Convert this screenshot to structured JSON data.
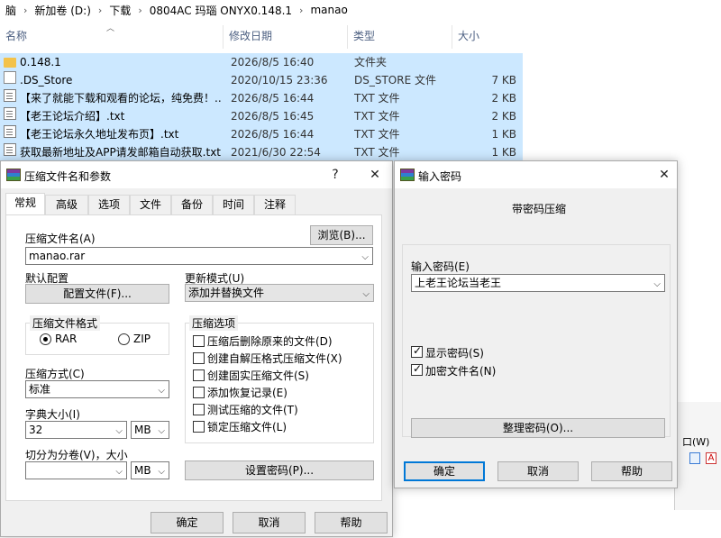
{
  "explorer": {
    "breadcrumb": [
      "脑",
      "新加卷 (D:)",
      "下载",
      "0804AC 玛瑙 ONYX0.148.1",
      "manao"
    ],
    "columns": {
      "name": "名称",
      "date": "修改日期",
      "type": "类型",
      "size": "大小"
    },
    "files": [
      {
        "name": "0.148.1",
        "date": "2026/8/5 16:40",
        "type": "文件夹",
        "size": "",
        "icon": "folder-icon"
      },
      {
        "name": ".DS_Store",
        "date": "2020/10/15 23:36",
        "type": "DS_STORE 文件",
        "size": "7 KB",
        "icon": "file-icon"
      },
      {
        "name": "【来了就能下载和观看的论坛，纯免费！...",
        "date": "2026/8/5 16:44",
        "type": "TXT 文件",
        "size": "2 KB",
        "icon": "txt-file-icon"
      },
      {
        "name": "【老王论坛介绍】.txt",
        "date": "2026/8/5 16:45",
        "type": "TXT 文件",
        "size": "2 KB",
        "icon": "txt-file-icon"
      },
      {
        "name": "【老王论坛永久地址发布页】.txt",
        "date": "2026/8/5 16:44",
        "type": "TXT 文件",
        "size": "1 KB",
        "icon": "txt-file-icon"
      },
      {
        "name": "获取最新地址及APP请发邮箱自动获取.txt",
        "date": "2021/6/30 22:54",
        "type": "TXT 文件",
        "size": "1 KB",
        "icon": "txt-file-icon"
      }
    ],
    "partial_text": "口(W)"
  },
  "archive_dialog": {
    "title": "压缩文件名和参数",
    "help_glyph": "?",
    "close_glyph": "✕",
    "tabs": [
      "常规",
      "高级",
      "选项",
      "文件",
      "备份",
      "时间",
      "注释"
    ],
    "active_tab": 0,
    "archive_name_label": "压缩文件名(A)",
    "browse_button": "浏览(B)...",
    "archive_name_value": "manao.rar",
    "default_profile_label": "默认配置",
    "profiles_button": "配置文件(F)...",
    "update_mode_label": "更新模式(U)",
    "update_mode_value": "添加并替换文件",
    "format_group_title": "压缩文件格式",
    "format_rar": "RAR",
    "format_zip": "ZIP",
    "options_group_title": "压缩选项",
    "options": [
      {
        "label": "压缩后删除原来的文件(D)",
        "checked": false
      },
      {
        "label": "创建自解压格式压缩文件(X)",
        "checked": false
      },
      {
        "label": "创建固实压缩文件(S)",
        "checked": false
      },
      {
        "label": "添加恢复记录(E)",
        "checked": false
      },
      {
        "label": "测试压缩的文件(T)",
        "checked": false
      },
      {
        "label": "锁定压缩文件(L)",
        "checked": false
      }
    ],
    "method_label": "压缩方式(C)",
    "method_value": "标准",
    "dict_label": "字典大小(I)",
    "dict_value": "32",
    "dict_unit": "MB",
    "split_label": "切分为分卷(V)，大小",
    "split_value": "",
    "split_unit": "MB",
    "set_password_button": "设置密码(P)...",
    "ok_button": "确定",
    "cancel_button": "取消",
    "help_button": "帮助"
  },
  "password_dialog": {
    "title": "输入密码",
    "close_glyph": "✕",
    "heading": "带密码压缩",
    "password_label": "输入密码(E)",
    "password_value": "上老王论坛当老王",
    "show_password_label": "显示密码(S)",
    "show_password_checked": true,
    "encrypt_names_label": "加密文件名(N)",
    "encrypt_names_checked": true,
    "organize_button": "整理密码(O)...",
    "ok_button": "确定",
    "cancel_button": "取消",
    "help_button": "帮助"
  },
  "colors": {
    "selection": "#cce8ff",
    "dialog_bg": "#f0f0f0",
    "focus_border": "#0078d7"
  }
}
